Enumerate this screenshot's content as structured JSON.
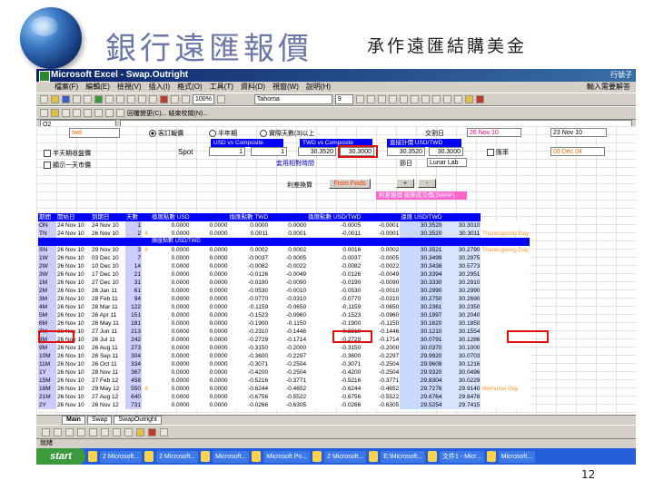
{
  "slide": {
    "title": "銀行遠匯報價",
    "subtitle": "承作遠匯結購美金",
    "page_number": "12"
  },
  "window": {
    "title": "Microsoft Excel - Swap.Outright",
    "title_right": "行號子",
    "menus": [
      "檔案(F)",
      "編輯(E)",
      "檢視(V)",
      "插入(I)",
      "格式(O)",
      "工具(T)",
      "資料(D)",
      "視窗(W)",
      "說明(H)"
    ],
    "menu_right": "輸入需要解答",
    "zoom": "100%",
    "font_name": "Tahoma",
    "font_size": "9",
    "toolbar_text": "回覆變更(C)... 結束校閱(N)...",
    "name_box": "O2"
  },
  "controls": {
    "currency_box": "twd",
    "radio_options": [
      "客訂報價",
      "半年期",
      "實際天數(3)以上"
    ],
    "check_label_1": "半天期收盤價",
    "check_label_2": "顯示一天市價",
    "spot_label": "Spot",
    "ccy_header_1": "USD vs Composite",
    "ccy_header_2": "TWD vs Composite",
    "ccy_header_3": "直接計價 USD/TWD",
    "spot_val_1": "1",
    "spot_val_2": "1",
    "spot_val_3": "30.3520",
    "spot_val_4": "30.3000",
    "spot_val_5": "30.3520",
    "spot_val_6": "30.3000",
    "spot_note": "套用相對時間",
    "holiday_label": "節日",
    "holiday_name": "Lunar Lab",
    "trade_date_label": "交割日",
    "trade_date": "26 Nov 10",
    "date2": "23 Nov 10",
    "date_flag": "匯率",
    "date3": "09 Dec 04",
    "btn_from": "From Fwds",
    "btn_small_1": "+",
    "btn_small_2": "-",
    "fwd_label": "利差換算",
    "pink_header": "利差報價 換算成交價(SWAP)"
  },
  "table": {
    "headers": [
      "期間",
      "開始日",
      "到期日",
      "天數",
      "",
      "換匯點數 USD",
      "",
      "換匯點數 TWD",
      "",
      "換匯點數 USD/TWD",
      "",
      "遠匯 USD/TWD",
      ""
    ],
    "sub_header": "換匯點數 USD/TWD",
    "rows": [
      [
        "ON",
        "24 Nov 10",
        "24 Nov 10",
        "1",
        "",
        "0.0000",
        "0.0000",
        "0.0000",
        "0.0000",
        "-0.0005",
        "-0.0001",
        "30.3520",
        "30.3010",
        ""
      ],
      [
        "TN",
        "24 Nov 10",
        "26 Nov 10",
        "2",
        "II",
        "0.0000",
        "0.0000",
        "0.0011",
        "0.0001",
        "-0.0011",
        "-0.0001",
        "30.3520",
        "30.3011",
        "Thanksgiving Day"
      ],
      [
        "SN",
        "26 Nov 10",
        "29 Nov 10",
        "3",
        "II",
        "0.0000",
        "0.0000",
        "0.0002",
        "0.0002",
        "0.0016",
        "0.0002",
        "30.3521",
        "30.2790",
        "Thanksgiving Day"
      ],
      [
        "1W",
        "26 Nov 10",
        "03 Dec 10",
        "7",
        "",
        "0.0000",
        "0.0000",
        "-0.0037",
        "-0.0005",
        "-0.0037",
        "-0.0005",
        "30.3499",
        "30.2975",
        ""
      ],
      [
        "2W",
        "26 Nov 10",
        "10 Dec 10",
        "14",
        "",
        "0.0000",
        "0.0000",
        "-0.0082",
        "-0.0022",
        "-0.0082",
        "-0.0022",
        "30.3438",
        "30.5773",
        ""
      ],
      [
        "3W",
        "26 Nov 10",
        "17 Dec 10",
        "21",
        "",
        "0.0000",
        "0.0000",
        "-0.0126",
        "-0.0049",
        "-0.0126",
        "-0.0049",
        "30.3394",
        "30.2951",
        ""
      ],
      [
        "1M",
        "26 Nov 10",
        "27 Dec 10",
        "31",
        "",
        "0.0000",
        "0.0000",
        "-0.0190",
        "-0.0090",
        "-0.0190",
        "-0.0090",
        "30.3330",
        "30.2910",
        ""
      ],
      [
        "2M",
        "26 Nov 10",
        "26 Jan 11",
        "61",
        "",
        "0.0000",
        "0.0000",
        "-0.0530",
        "-0.0010",
        "-0.0530",
        "-0.0010",
        "30.2990",
        "30.2990",
        ""
      ],
      [
        "3M",
        "26 Nov 10",
        "28 Feb 11",
        "94",
        "",
        "0.0000",
        "0.0000",
        "-0.0770",
        "-0.0310",
        "-0.0770",
        "-0.0310",
        "30.2750",
        "30.2690",
        ""
      ],
      [
        "4M",
        "26 Nov 10",
        "28 Mar 11",
        "122",
        "",
        "0.0000",
        "0.0000",
        "-0.1159",
        "-0.0650",
        "-0.1159",
        "-0.0650",
        "30.2361",
        "30.2350",
        ""
      ],
      [
        "5M",
        "26 Nov 10",
        "26 Apr 11",
        "151",
        "",
        "0.0000",
        "0.0000",
        "-0.1523",
        "-0.0960",
        "-0.1523",
        "-0.0960",
        "30.1997",
        "30.2040",
        ""
      ],
      [
        "6M",
        "26 Nov 10",
        "26 May 11",
        "181",
        "",
        "0.0000",
        "0.0000",
        "-0.1900",
        "-0.1150",
        "-0.1900",
        "-0.1150",
        "30.1620",
        "30.1850",
        ""
      ],
      [
        "7M",
        "26 Nov 10",
        "27 Jun 11",
        "213",
        "",
        "0.0000",
        "0.0000",
        "-0.2310",
        "-0.1446",
        "-0.2310",
        "-0.1446",
        "30.1210",
        "30.1554",
        ""
      ],
      [
        "8M",
        "26 Nov 10",
        "26 Jul 11",
        "242",
        "",
        "0.0000",
        "0.0000",
        "-0.2729",
        "-0.1714",
        "-0.2729",
        "-0.1714",
        "30.0791",
        "30.1286",
        ""
      ],
      [
        "9M",
        "26 Nov 10",
        "26 Aug 11",
        "273",
        "",
        "0.0000",
        "0.0000",
        "-0.3150",
        "-0.2000",
        "-0.3150",
        "-0.2000",
        "30.0370",
        "30.1000",
        ""
      ],
      [
        "10M",
        "26 Nov 10",
        "26 Sep 11",
        "304",
        "",
        "0.0000",
        "0.0000",
        "-0.3600",
        "-0.2297",
        "-0.3600",
        "-0.2297",
        "29.9920",
        "30.0703",
        ""
      ],
      [
        "11M",
        "26 Nov 10",
        "26 Oct 11",
        "334",
        "",
        "0.0000",
        "0.0000",
        "-0.3071",
        "-0.2504",
        "-0.3071",
        "-0.2504",
        "29.9609",
        "30.1216",
        ""
      ],
      [
        "1Y",
        "26 Nov 10",
        "28 Nov 11",
        "367",
        "",
        "0.0000",
        "0.0000",
        "-0.4200",
        "-0.2504",
        "-0.4200",
        "-0.2504",
        "29.9320",
        "30.0496",
        ""
      ],
      [
        "15M",
        "26 Nov 10",
        "27 Feb 12",
        "458",
        "",
        "0.0000",
        "0.0000",
        "-0.5216",
        "-0.3771",
        "-0.5216",
        "-0.3771",
        "29.8304",
        "30.0229",
        ""
      ],
      [
        "18M",
        "26 Nov 10",
        "29 May 12",
        "550",
        "II",
        "0.0000",
        "0.0000",
        "-0.6244",
        "-0.4652",
        "-0.6244",
        "-0.4652",
        "29.7276",
        "29.9140",
        "Memorial Day"
      ],
      [
        "21M",
        "26 Nov 10",
        "27 Aug 12",
        "640",
        "",
        "0.0000",
        "0.0000",
        "-0.6756",
        "-0.5522",
        "-0.6756",
        "-0.5522",
        "29.6764",
        "29.8478",
        ""
      ],
      [
        "2Y",
        "26 Nov 10",
        "26 Nov 12",
        "731",
        "",
        "0.0000",
        "0.0000",
        "-0.0266",
        "-0.6305",
        "-0.0266",
        "-0.6305",
        "29.5254",
        "29.7415",
        ""
      ]
    ]
  },
  "sheet_tabs": [
    "Main",
    "Swap",
    "SwapOutright"
  ],
  "status_text": "就緒",
  "taskbar": {
    "start": "start",
    "items": [
      "2 Microsoft...",
      "2 Microsoft...",
      "Microsoft...",
      "Microsoft Po...",
      "2 Microsoft...",
      "E:\\Microsoft...",
      "文件1 - Micr...",
      "Microsoft..."
    ]
  }
}
